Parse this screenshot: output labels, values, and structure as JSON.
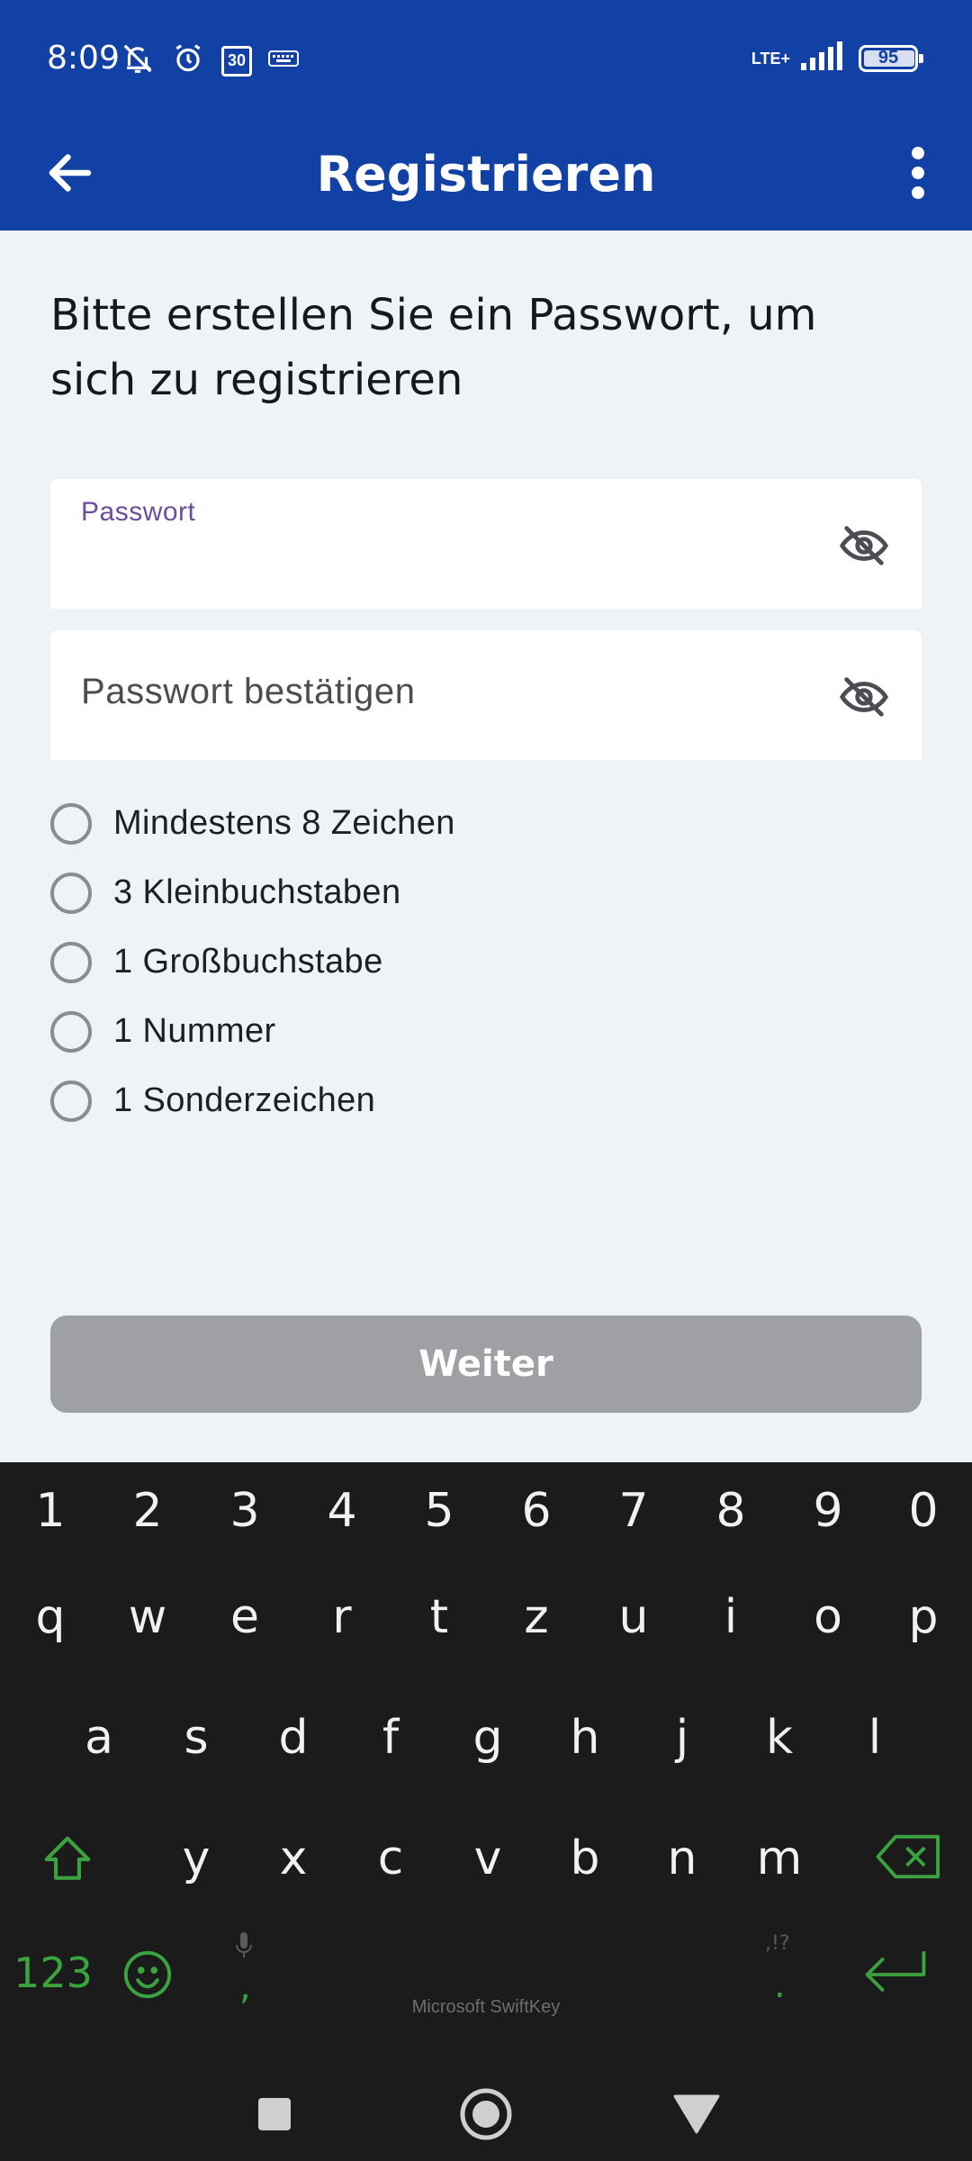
{
  "status_bar": {
    "time": "8:09",
    "network": "LTE+",
    "battery": "95",
    "calendar_day": "30"
  },
  "app_bar": {
    "title": "Registrieren"
  },
  "heading": "Bitte erstellen Sie ein Passwort, um sich zu registrieren",
  "password_field": {
    "label": "Passwort",
    "value": ""
  },
  "confirm_field": {
    "placeholder": "Passwort bestätigen",
    "value": ""
  },
  "requirements": [
    {
      "label": "Mindestens 8 Zeichen",
      "met": false
    },
    {
      "label": "3 Kleinbuchstaben",
      "met": false
    },
    {
      "label": "1 Großbuchstabe",
      "met": false
    },
    {
      "label": "1 Nummer",
      "met": false
    },
    {
      "label": "1 Sonderzeichen",
      "met": false
    }
  ],
  "submit_button": {
    "label": "Weiter",
    "enabled": false
  },
  "keyboard": {
    "brand": "Microsoft SwiftKey",
    "number_row": [
      "1",
      "2",
      "3",
      "4",
      "5",
      "6",
      "7",
      "8",
      "9",
      "0"
    ],
    "row1": [
      "q",
      "w",
      "e",
      "r",
      "t",
      "z",
      "u",
      "i",
      "o",
      "p"
    ],
    "row2": [
      "a",
      "s",
      "d",
      "f",
      "g",
      "h",
      "j",
      "k",
      "l"
    ],
    "row3": [
      "y",
      "x",
      "c",
      "v",
      "b",
      "n",
      "m"
    ],
    "symbols_key": "123",
    "comma_key": ",",
    "period_key": ".",
    "punct_hint": ",!?"
  },
  "colors": {
    "primary": "#1241a5",
    "background": "#eff2f7",
    "label_accent": "#6a4d9c",
    "button_disabled": "#9fa0a3",
    "keyboard_bg": "#1b1b1b",
    "keyboard_accent": "#3aa33f"
  }
}
